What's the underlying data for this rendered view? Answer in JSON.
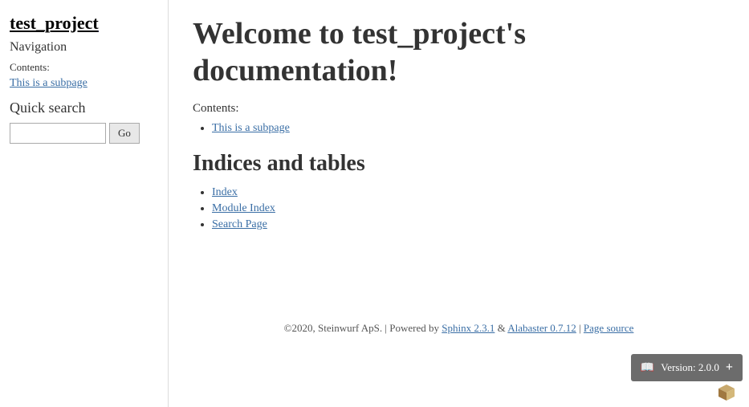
{
  "sidebar": {
    "project_title": "test_project",
    "nav_label": "Navigation",
    "contents_label": "Contents:",
    "subpage_link": "This is a subpage",
    "quick_search_label": "Quick search",
    "search_input_value": "",
    "search_button_label": "Go"
  },
  "main": {
    "heading": "Welcome to test_project's documentation!",
    "contents_label": "Contents:",
    "toc_items": [
      {
        "label": "This is a subpage",
        "href": "#"
      }
    ],
    "indices_heading": "Indices and tables",
    "indices_items": [
      {
        "label": "Index",
        "href": "#"
      },
      {
        "label": "Module Index",
        "href": "#"
      },
      {
        "label": "Search Page",
        "href": "#"
      }
    ]
  },
  "footer": {
    "text": "©2020, Steinwurf ApS. | Powered by",
    "sphinx_label": "Sphinx 2.3.1",
    "and": "&",
    "alabaster_label": "Alabaster 0.7.12",
    "separator": "|",
    "page_source_label": "Page source"
  },
  "version_badge": {
    "icon": "📖",
    "label": "Version: 2.0.0",
    "plus": "+"
  }
}
